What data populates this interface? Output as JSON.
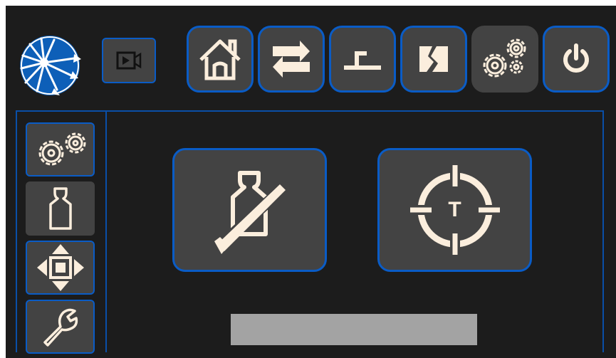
{
  "colors": {
    "background": "#1c1c1c",
    "button_fill": "#434343",
    "accent_border": "#0a5cc6",
    "icon_cream": "#fbeedd",
    "status_bar": "#a3a3a3"
  },
  "header": {
    "logo_icon": "starburst-arrows-logo",
    "camera_icon": "video-camera-icon",
    "nav": [
      {
        "icon": "home-icon",
        "active": false
      },
      {
        "icon": "transfer-arrows-icon",
        "active": false
      },
      {
        "icon": "hook-icon",
        "active": false
      },
      {
        "icon": "split-door-icon",
        "active": false
      },
      {
        "icon": "gears-icon",
        "active": true
      },
      {
        "icon": "power-icon",
        "active": false
      }
    ]
  },
  "sidebar": {
    "items": [
      {
        "icon": "gears-icon",
        "active": false
      },
      {
        "icon": "weight-icon",
        "active": true
      },
      {
        "icon": "move-arrows-icon",
        "active": false
      },
      {
        "icon": "wrench-icon",
        "active": false
      }
    ]
  },
  "main": {
    "actions": [
      {
        "icon": "weight-zero-icon"
      },
      {
        "icon": "tare-target-icon",
        "label": "T"
      }
    ],
    "status_text": ""
  }
}
